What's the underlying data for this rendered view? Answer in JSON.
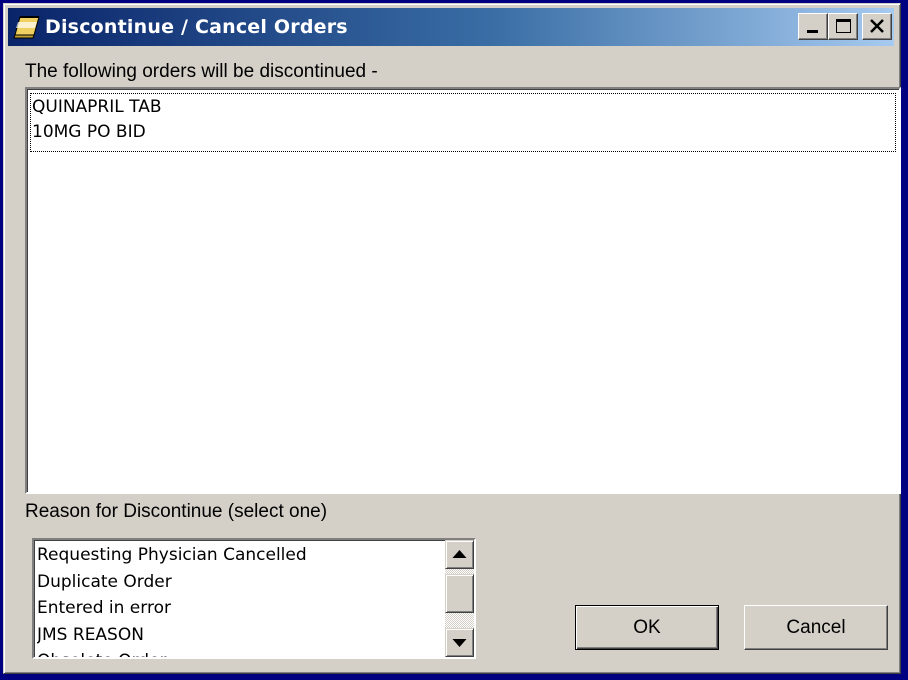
{
  "window": {
    "title": "Discontinue / Cancel Orders",
    "title_icon": "notepad-icon",
    "controls": [
      "minimize-icon",
      "maximize-icon",
      "close-icon"
    ]
  },
  "orders": {
    "label": "The following orders will be discontinued -",
    "items": [
      {
        "lines": [
          "QUINAPRIL TAB",
          "10MG PO BID"
        ]
      }
    ]
  },
  "reason": {
    "label": "Reason for Discontinue (select one)",
    "options": [
      "Requesting Physician Cancelled",
      "Duplicate Order",
      "Entered in error",
      "JMS REASON",
      "Obsolete Order"
    ]
  },
  "buttons": {
    "ok": "OK",
    "cancel": "Cancel"
  },
  "colors": {
    "desktop": "#000080",
    "titlebar_start": "#0a246a",
    "titlebar_end": "#a6caf0",
    "face": "#d4d0c8"
  }
}
